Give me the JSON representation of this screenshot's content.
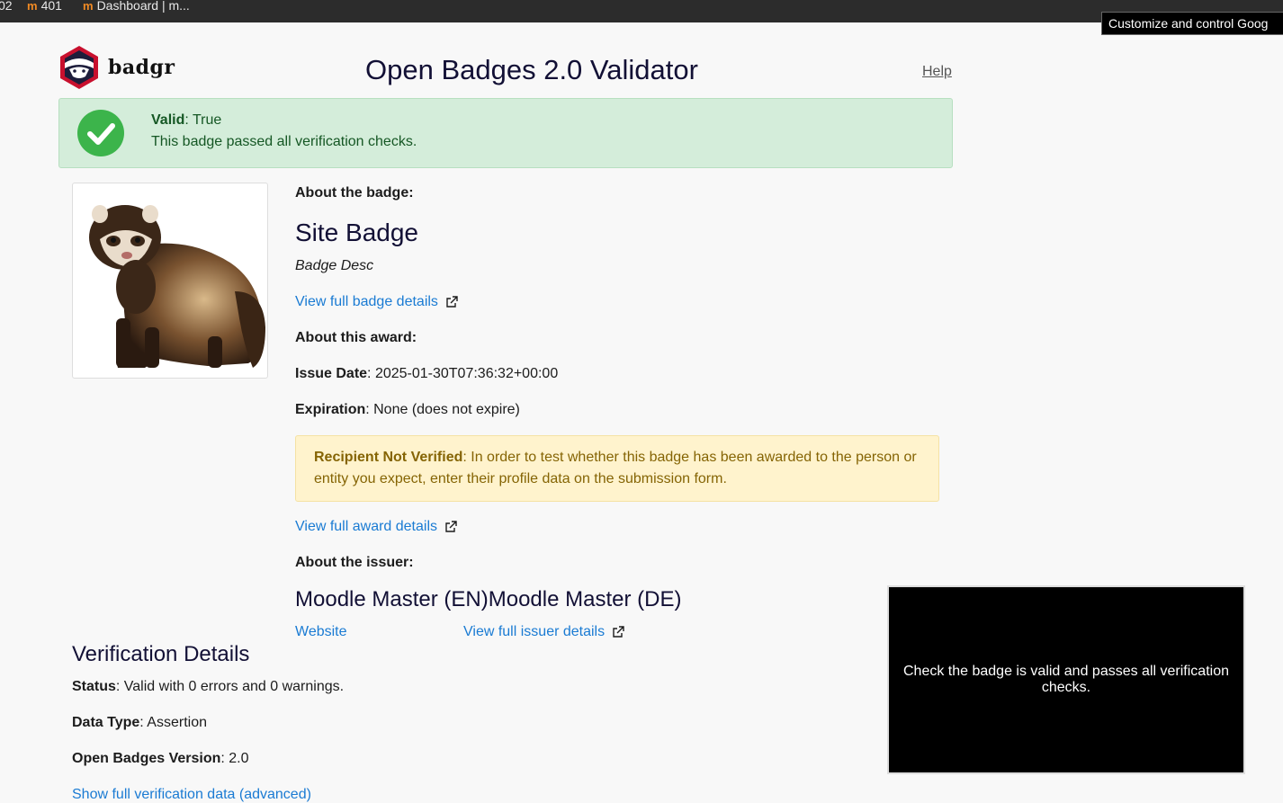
{
  "browser": {
    "bookmarks": [
      {
        "label": "02",
        "icon": "moodle-icon"
      },
      {
        "label": "401",
        "icon": "moodle-icon"
      },
      {
        "label": "Dashboard | m...",
        "icon": "moodle-icon"
      }
    ],
    "tooltip": "Customize and control Goog"
  },
  "header": {
    "logo_text": "badgr",
    "title": "Open Badges 2.0 Validator",
    "help_label": "Help"
  },
  "result": {
    "valid_label": "Valid",
    "valid_value": ": True",
    "message": "This badge passed all verification checks."
  },
  "badge": {
    "about_heading": "About the badge:",
    "name": "Site Badge",
    "description": "Badge Desc",
    "details_link": "View full badge details"
  },
  "award": {
    "about_heading": "About this award:",
    "issue_date_label": "Issue Date",
    "issue_date_value": ": 2025-01-30T07:36:32+00:00",
    "expiration_label": "Expiration",
    "expiration_value": ": None (does not expire)",
    "warning_label": "Recipient Not Verified",
    "warning_text": ": In order to test whether this badge has been awarded to the person or entity you expect, enter their profile data on the submission form.",
    "details_link": "View full award details"
  },
  "issuer": {
    "about_heading": "About the issuer:",
    "name": "Moodle Master (EN)Moodle Master (DE)",
    "website_link": "Website",
    "details_link": "View full issuer details"
  },
  "verification": {
    "title": "Verification Details",
    "status_label": "Status",
    "status_value": ": Valid with 0 errors and 0 warnings.",
    "data_type_label": "Data Type",
    "data_type_value": ": Assertion",
    "version_label": "Open Badges Version",
    "version_value": ": 2.0",
    "full_data_link": "Show full verification data (advanced)"
  },
  "callout": {
    "text": "Check the badge is valid and passes all verification checks."
  },
  "colors": {
    "link": "#1a7bd3",
    "success_bg": "#d4edda",
    "success_text": "#155724",
    "warning_bg": "#fff3cd",
    "warning_text": "#856404",
    "title": "#121035"
  }
}
